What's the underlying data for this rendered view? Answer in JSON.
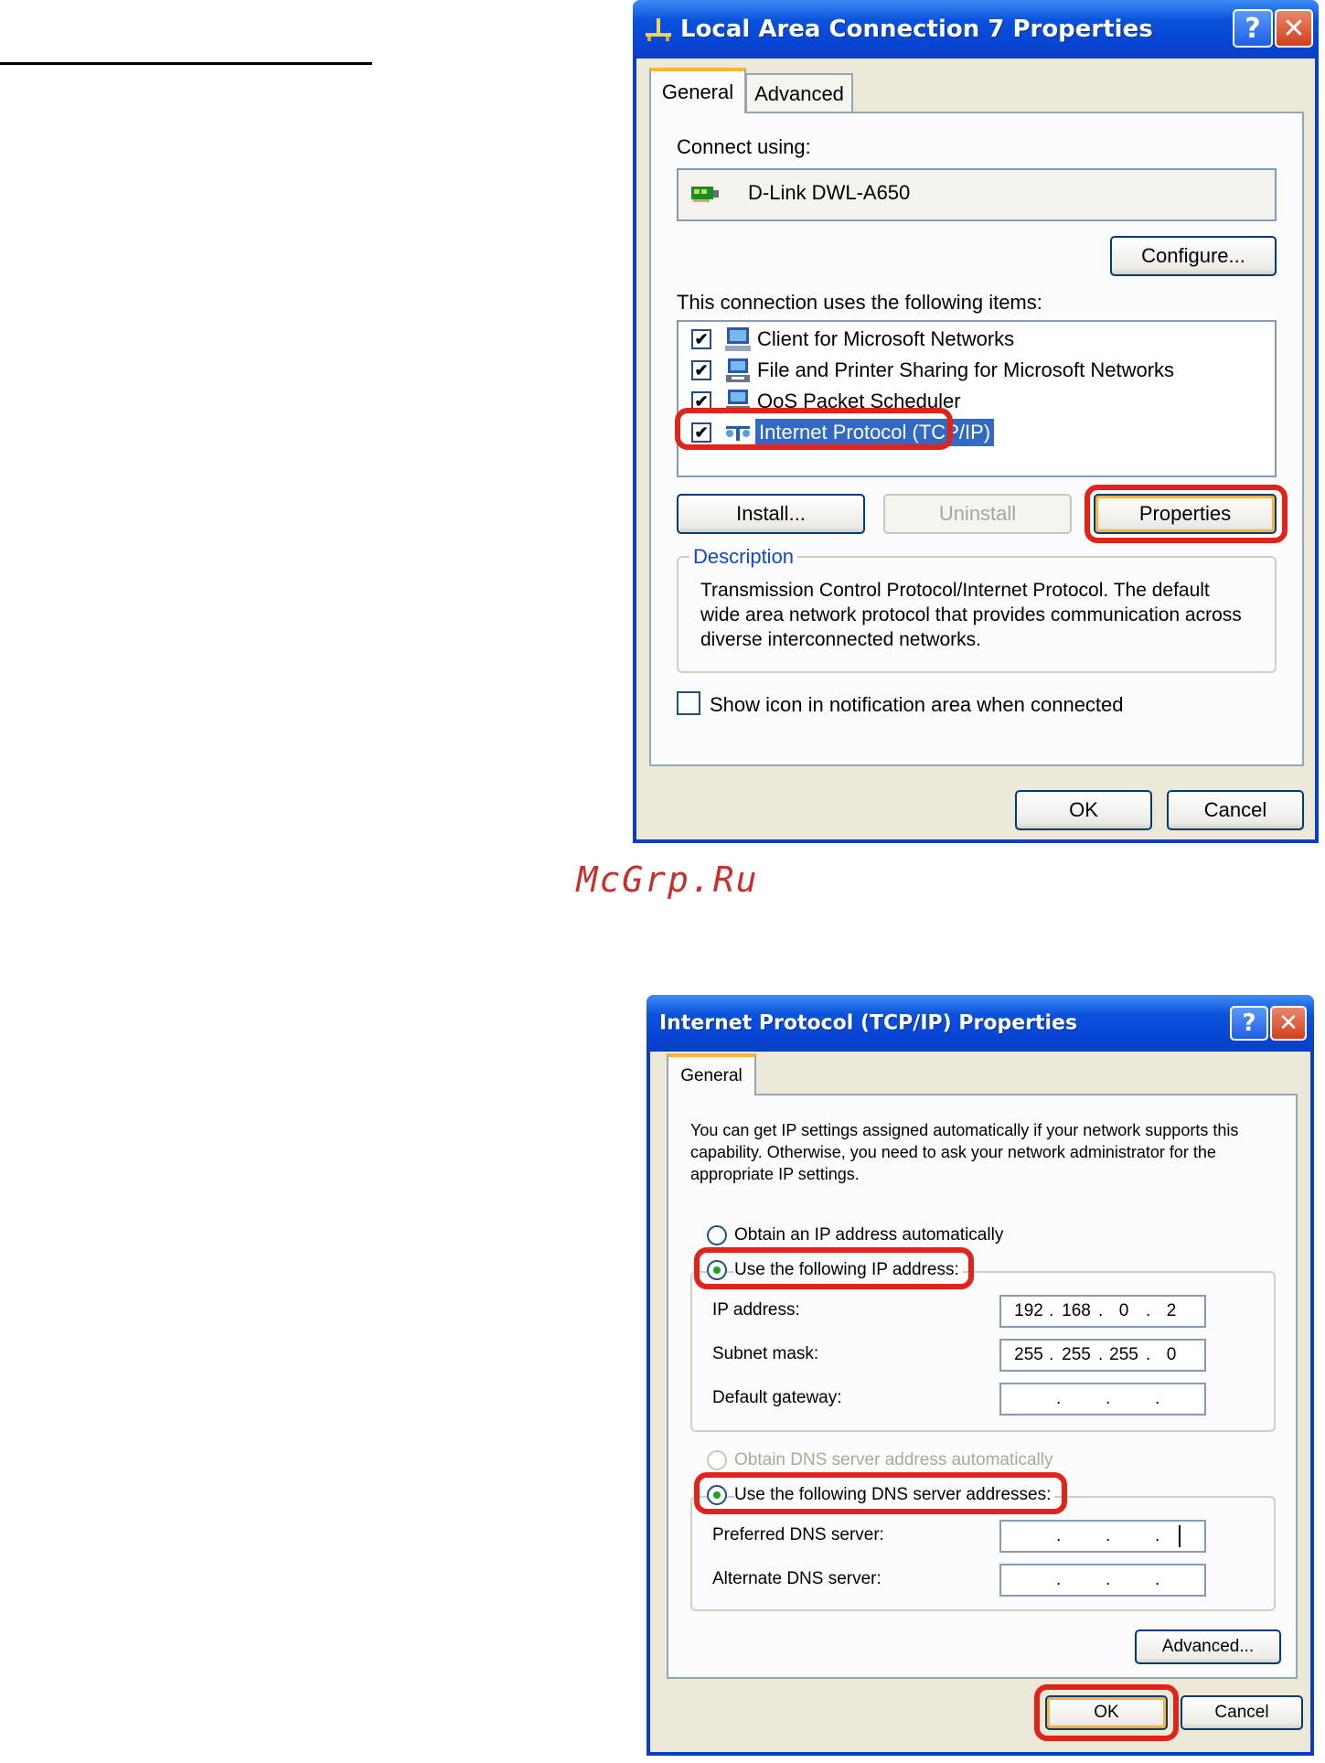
{
  "watermark": "McGrp.Ru",
  "window1": {
    "title": "Local Area Connection 7 Properties",
    "tabs": [
      "General",
      "Advanced"
    ],
    "connect_using_label": "Connect using:",
    "adapter_name": "D-Link DWL-A650",
    "configure_button": "Configure...",
    "items_label": "This connection uses the following items:",
    "items": [
      {
        "label": "Client for Microsoft Networks",
        "checked": true,
        "icon": "network-client-icon"
      },
      {
        "label": "File and Printer Sharing for Microsoft Networks",
        "checked": true,
        "icon": "file-printer-sharing-icon"
      },
      {
        "label": "QoS Packet Scheduler",
        "checked": true,
        "icon": "qos-scheduler-icon"
      },
      {
        "label": "Internet Protocol (TCP/IP)",
        "checked": true,
        "icon": "tcpip-protocol-icon",
        "selected": true
      }
    ],
    "install_button": "Install...",
    "uninstall_button": "Uninstall",
    "properties_button": "Properties",
    "description_legend": "Description",
    "description_text": "Transmission Control Protocol/Internet Protocol. The default wide area network protocol that provides communication across diverse interconnected networks.",
    "show_icon_label": "Show icon in notification area when connected",
    "ok_button": "OK",
    "cancel_button": "Cancel"
  },
  "window2": {
    "title": "Internet Protocol (TCP/IP) Properties",
    "tabs": [
      "General"
    ],
    "intro_text": "You can get IP settings assigned automatically if your network supports this capability. Otherwise, you need to ask your network administrator for the appropriate IP settings.",
    "radio_auto_ip": "Obtain an IP address automatically",
    "radio_static_ip": "Use the following IP address:",
    "ip_address_label": "IP address:",
    "ip_address": [
      "192",
      "168",
      "0",
      "2"
    ],
    "subnet_mask_label": "Subnet mask:",
    "subnet_mask": [
      "255",
      "255",
      "255",
      "0"
    ],
    "gateway_label": "Default gateway:",
    "gateway": [
      "",
      "",
      "",
      ""
    ],
    "radio_auto_dns": "Obtain DNS server address automatically",
    "radio_static_dns": "Use the following DNS server addresses:",
    "preferred_dns_label": "Preferred DNS server:",
    "preferred_dns": [
      "",
      "",
      "",
      ""
    ],
    "alternate_dns_label": "Alternate DNS server:",
    "alternate_dns": [
      "",
      "",
      "",
      ""
    ],
    "advanced_button": "Advanced...",
    "ok_button": "OK",
    "cancel_button": "Cancel"
  },
  "colors": {
    "titlebar": "#0a52dc",
    "highlight_outline": "#e2231a",
    "selection": "#316ac5",
    "dialog_bg": "#ece9d8"
  }
}
